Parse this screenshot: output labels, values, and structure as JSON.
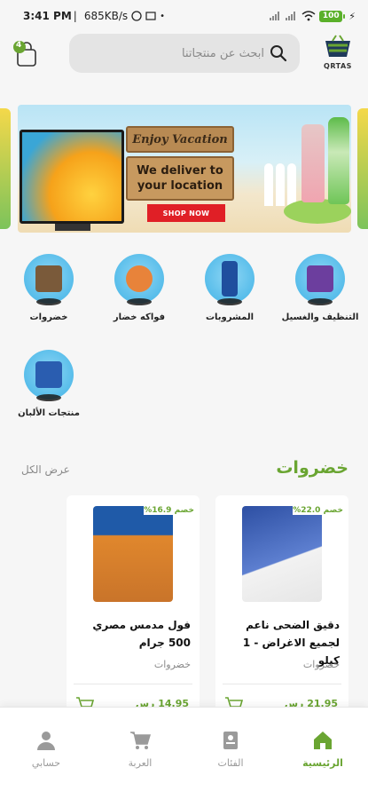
{
  "status_bar": {
    "time": "3:41 PM",
    "speed": "685KB/s",
    "battery": "100"
  },
  "header": {
    "search_placeholder": "ابحث عن منتجاتنا",
    "brand_name": "QRTAS",
    "cart_badge_count": "4"
  },
  "banner": {
    "headline": "Enjoy Vacation",
    "line1": "We deliver to",
    "line2": "your location",
    "cta": "SHOP NOW"
  },
  "categories": [
    {
      "label": "خضروات",
      "color": "#7a5a3a"
    },
    {
      "label": "فواكه خضار",
      "color": "#e8833a"
    },
    {
      "label": "المشروبات",
      "color": "#1f4f9e"
    },
    {
      "label": "التنظيف والغسيل",
      "color": "#6c3e9e"
    },
    {
      "label": "منتجات الألبان",
      "color": "#2a5db0"
    }
  ],
  "section": {
    "title": "خضروات",
    "view_all": "عرض الكل"
  },
  "products": [
    {
      "discount": "خصم 22.0%",
      "name": "دقيق الضحى ناعم لجميع الاغراض - 1 كيلو",
      "category": "خضروات",
      "price": "21.95 رس",
      "color": "#2d4fa3"
    },
    {
      "discount": "خصم 16.9%",
      "name": "فول مدمس مصري 500 جرام",
      "category": "خضروات",
      "price": "14.95 رس",
      "color": "#e0872d"
    }
  ],
  "bottom_nav": [
    {
      "label": "الرئيسية",
      "icon": "home-icon",
      "active": true
    },
    {
      "label": "الفئات",
      "icon": "categories-icon",
      "active": false
    },
    {
      "label": "العربة",
      "icon": "cart-icon",
      "active": false
    },
    {
      "label": "حسابي",
      "icon": "account-icon",
      "active": false
    }
  ],
  "colors": {
    "accent": "#6aa532",
    "nav_inactive": "#9a9a9a"
  }
}
